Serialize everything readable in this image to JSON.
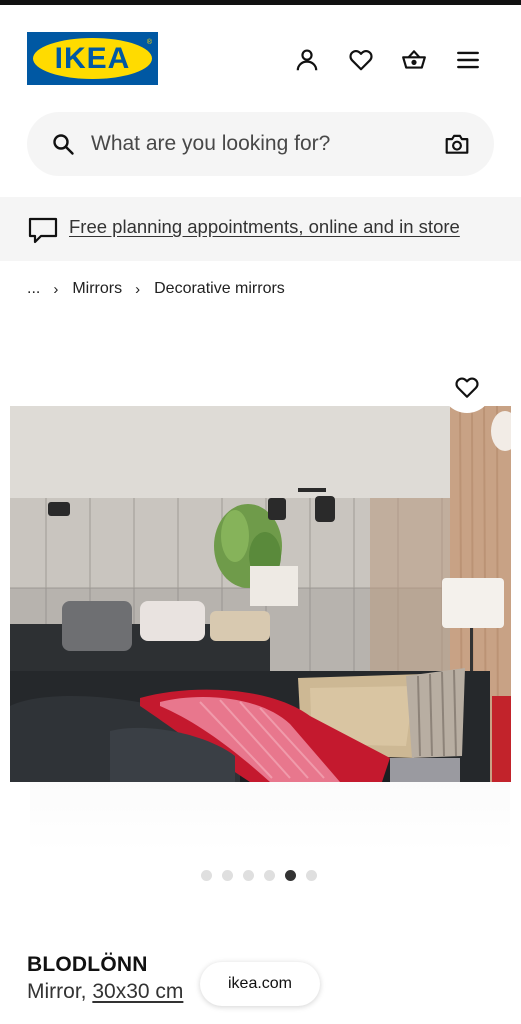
{
  "header": {
    "logo_text": "IKEA",
    "icons": [
      "user-icon",
      "heart-icon",
      "basket-icon",
      "hamburger-menu-icon"
    ]
  },
  "search": {
    "placeholder": "What are you looking for?",
    "icons": [
      "search-icon",
      "camera-icon"
    ]
  },
  "banner": {
    "text": "Free planning appointments, online and in store",
    "icon": "chat-bubble-icon"
  },
  "breadcrumb": {
    "items": [
      "...",
      "Mirrors",
      "Decorative mirrors"
    ],
    "separator": "›"
  },
  "gallery": {
    "total_images": 6,
    "active_index": 4,
    "image_alt": "Mirror tiles on wall above sofa with red throw and cushions"
  },
  "product": {
    "name": "BLODLÖNN",
    "type": "Mirror,",
    "size": "30x30 cm"
  },
  "browser": {
    "url": "ikea.com"
  },
  "colors": {
    "brand_blue": "#0058a3",
    "brand_yellow": "#ffdb00",
    "surface_grey": "#f5f5f5"
  }
}
